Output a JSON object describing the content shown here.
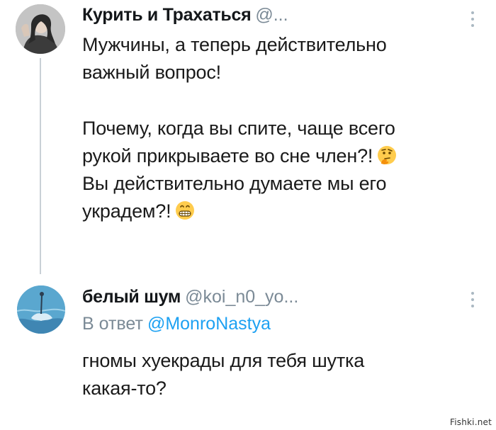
{
  "tweets": [
    {
      "author_name": "Курить и Трахаться",
      "author_handle": "@...",
      "paragraph1": [
        "Мужчины, а теперь действительно",
        "важный вопрос!"
      ],
      "paragraph2": [
        "Почему, когда вы спите, чаще всего",
        "рукой прикрываете во сне член?!",
        "Вы действительно думаете мы его",
        "украдем?!"
      ],
      "emojis": [
        "thinking-face",
        "grimacing-face"
      ]
    },
    {
      "author_name": "белый шум",
      "author_handle": "@koi_n0_yo...",
      "reply_prefix": "В ответ",
      "reply_handle": "@MonroNastya",
      "body": [
        "гномы хуекрады для тебя шутка",
        "какая-то?"
      ]
    }
  ],
  "watermark": "Fishki.net",
  "colors": {
    "link": "#1da1f2",
    "muted": "#7b8a96",
    "thread_line": "#c9d0d6"
  }
}
